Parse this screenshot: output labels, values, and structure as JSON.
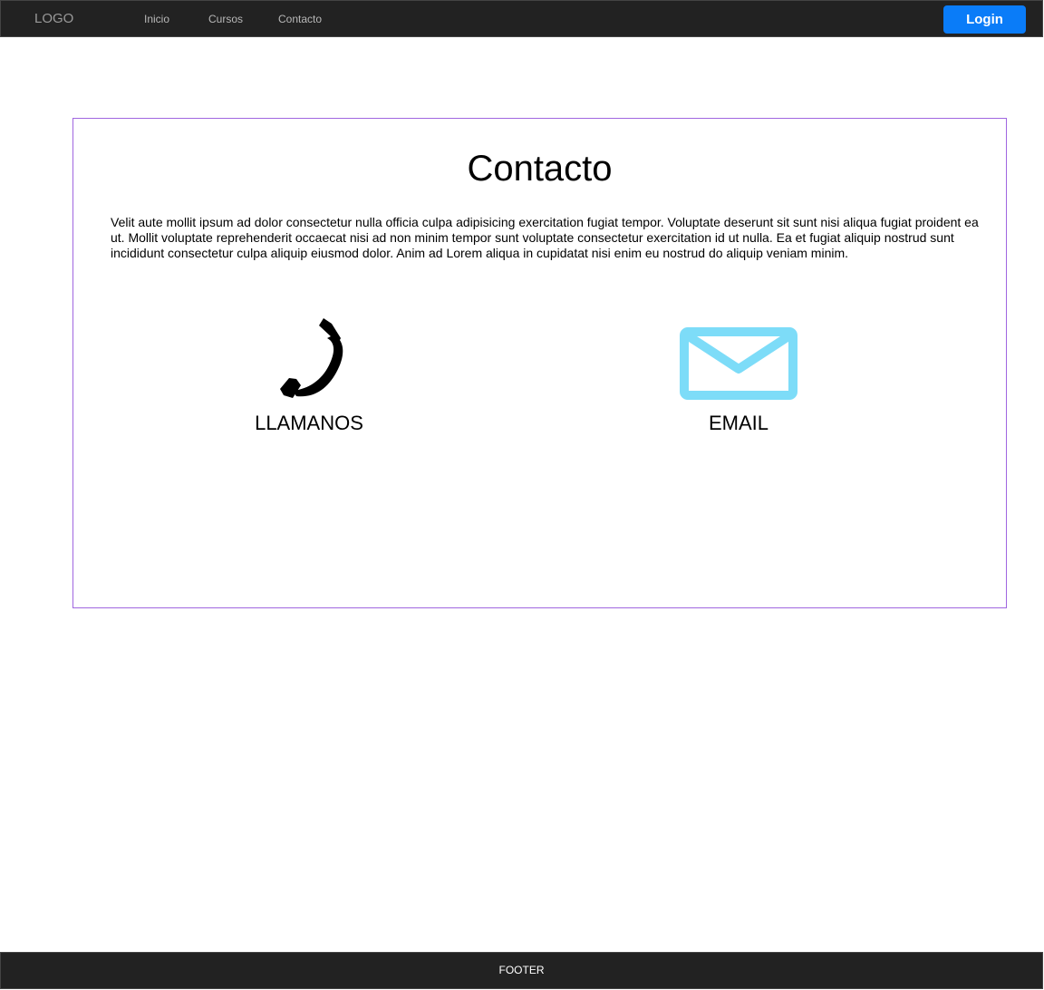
{
  "header": {
    "logo": "LOGO",
    "nav": {
      "inicio": "Inicio",
      "cursos": "Cursos",
      "contacto": "Contacto"
    },
    "login_label": "Login"
  },
  "main": {
    "title": "Contacto",
    "description": "Velit aute mollit ipsum ad dolor consectetur nulla officia culpa adipisicing exercitation fugiat tempor. Voluptate deserunt sit sunt nisi aliqua fugiat proident ea ut. Mollit voluptate reprehenderit occaecat nisi ad non minim tempor sunt voluptate consectetur exercitation id ut nulla. Ea et fugiat aliquip nostrud sunt incididunt consectetur culpa aliquip eiusmod dolor. Anim ad Lorem aliqua in cupidatat nisi enim eu nostrud do aliquip veniam minim.",
    "contacts": [
      {
        "label": "LLAMANOS",
        "icon": "phone-icon"
      },
      {
        "label": "EMAIL",
        "icon": "mail-icon"
      }
    ]
  },
  "footer": {
    "text": "FOOTER"
  },
  "colors": {
    "navbar_bg": "#222222",
    "login_button": "#0a7cf8",
    "panel_border": "#a066e0",
    "mail_icon": "#7ddcf8",
    "phone_icon": "#000000"
  }
}
